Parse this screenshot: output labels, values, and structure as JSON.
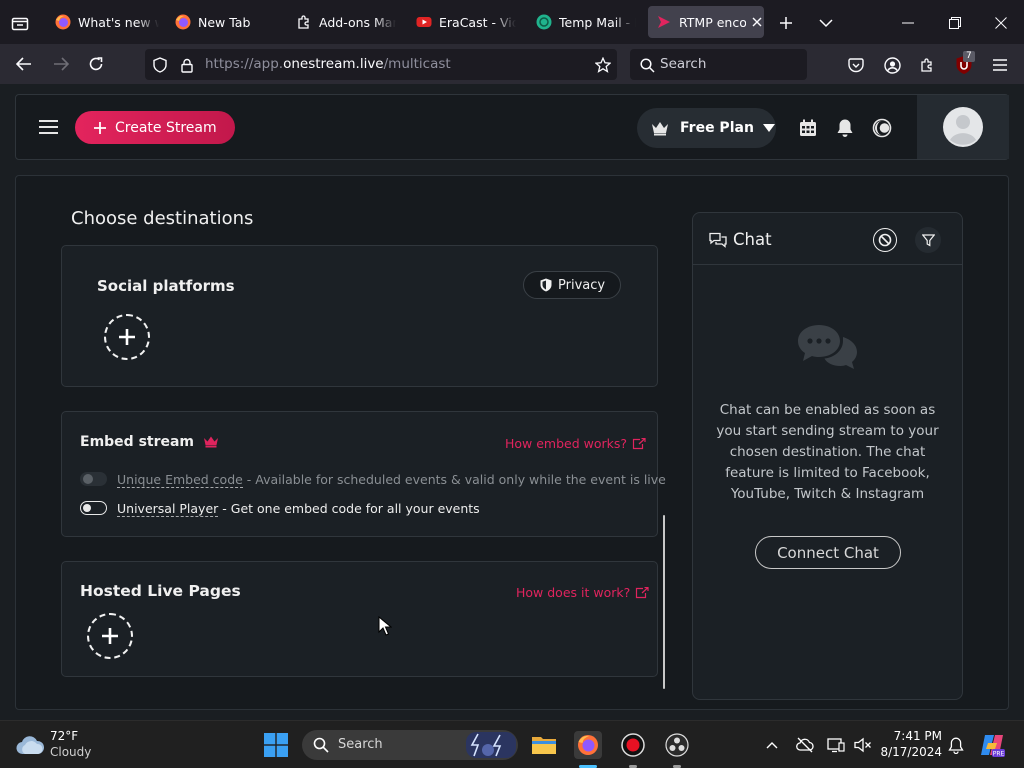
{
  "browser": {
    "tabs": [
      {
        "title": "What's new w",
        "icon": "firefox-icon"
      },
      {
        "title": "New Tab",
        "icon": "firefox-icon"
      },
      {
        "title": "Add-ons Mana",
        "icon": "puzzle-icon"
      },
      {
        "title": "EraCast - Vide",
        "icon": "youtube-icon"
      },
      {
        "title": "Temp Mail - D",
        "icon": "tempmail-icon"
      },
      {
        "title": "RTMP enco",
        "icon": "rtmp-icon"
      }
    ],
    "url_prefix": "https://app.",
    "url_host": "onestream.live",
    "url_path": "/multicast",
    "search_placeholder": "Search",
    "extension_badge": "7",
    "accent_color": "#e0245e"
  },
  "app": {
    "create_stream_label": "Create Stream",
    "plan_label": "Free Plan"
  },
  "destinations": {
    "title": "Choose destinations",
    "social_title": "Social platforms",
    "privacy_label": "Privacy",
    "embed_title": "Embed stream",
    "embed_help": "How embed works?",
    "unique_embed_label": "Unique Embed code",
    "unique_embed_desc": " - Available for scheduled events & valid only while the event is live",
    "universal_label": "Universal Player",
    "universal_desc": " - Get one embed code for all your events",
    "hosted_title": "Hosted Live Pages",
    "hosted_help": "How does it work?"
  },
  "chat": {
    "title": "Chat",
    "message": "Chat can be enabled as soon as you start sending stream to your chosen destination. The chat feature is limited to Facebook, YouTube, Twitch & Instagram",
    "connect_label": "Connect Chat"
  },
  "taskbar": {
    "weather_temp": "72°F",
    "weather_desc": "Cloudy",
    "search_label": "Search",
    "time": "7:41 PM",
    "date": "8/17/2024"
  }
}
